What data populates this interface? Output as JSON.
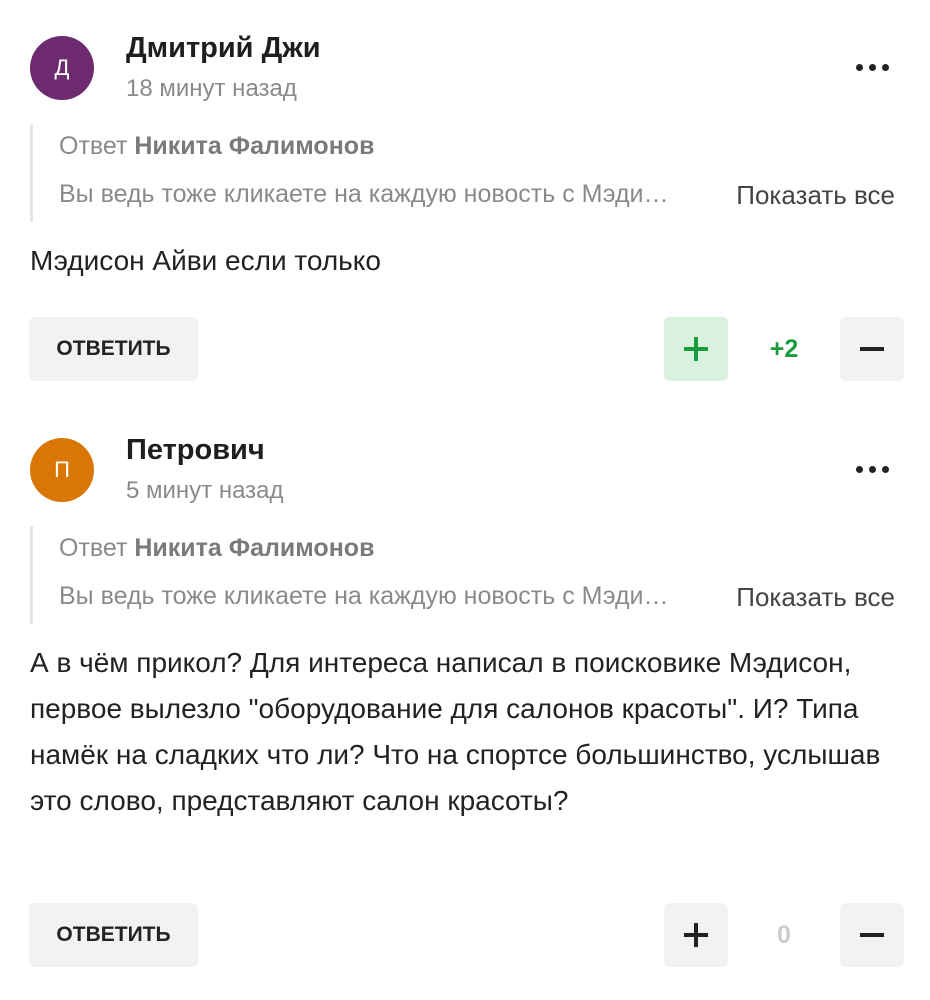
{
  "comments": [
    {
      "avatar_letter": "Д",
      "avatar_color": "#6e2a6e",
      "author": "Дмитрий Джи",
      "time": "18 минут назад",
      "reply_to_prefix": "Ответ",
      "reply_to_name": "Никита Фалимонов",
      "quote_text": "Вы ведь тоже кликаете на каждую новость с Мэдисон…",
      "show_all": "Показать все",
      "text": "Мэдисон Айви если только",
      "reply_label": "ОТВЕТИТЬ",
      "score": "+2",
      "score_color": "#1a9c3c",
      "voted_plus": true,
      "icons": {
        "more": "more-dots-icon",
        "plus": "plus-icon",
        "minus": "minus-icon"
      }
    },
    {
      "avatar_letter": "П",
      "avatar_color": "#d97706",
      "author": "Петрович",
      "time": "5 минут назад",
      "reply_to_prefix": "Ответ",
      "reply_to_name": "Никита Фалимонов",
      "quote_text": "Вы ведь тоже кликаете на каждую новость с Мэдисон…",
      "show_all": "Показать все",
      "text": "А в чём прикол? Для интереса написал в поисковике Мэдисон, первое вылезло \"оборудование для салонов красоты\". И? Типа намёк на сладких что ли? Что на спортсе большинство, услышав это слово, представляют салон красоты?",
      "reply_label": "ОТВЕТИТЬ",
      "score": "0",
      "score_color": "#cccccc",
      "voted_plus": false,
      "icons": {
        "more": "more-dots-icon",
        "plus": "plus-icon",
        "minus": "minus-icon"
      }
    }
  ]
}
